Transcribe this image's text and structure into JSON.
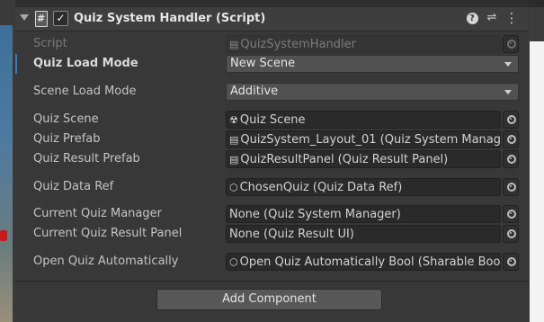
{
  "component": {
    "title": "Quiz System Handler (Script)",
    "enabled_mark": "✓",
    "header_icons": [
      "help-icon",
      "preset-icon",
      "context-menu-icon"
    ]
  },
  "fields": [
    {
      "label": "Script",
      "value": "QuizSystemHandler",
      "kind": "object",
      "icon": "script-asset-icon",
      "disabled": true
    },
    {
      "label": "Quiz Load Mode",
      "value": "New Scene",
      "kind": "dropdown"
    },
    {
      "label": "Scene Load Mode",
      "value": "Additive",
      "kind": "dropdown"
    },
    {
      "label": "Quiz Scene",
      "value": "Quiz Scene",
      "kind": "object",
      "icon": "scene-asset-icon"
    },
    {
      "label": "Quiz Prefab",
      "value": "QuizSystem_Layout_01 (Quiz System Manage",
      "kind": "object",
      "icon": "prefab-asset-icon"
    },
    {
      "label": "Quiz Result Prefab",
      "value": "QuizResultPanel (Quiz Result Panel)",
      "kind": "object",
      "icon": "prefab-asset-icon"
    },
    {
      "label": "Quiz Data Ref",
      "value": "ChosenQuiz (Quiz Data Ref)",
      "kind": "object",
      "icon": "scriptable-object-icon"
    },
    {
      "label": "Current Quiz Manager",
      "value": "None (Quiz System Manager)",
      "kind": "object"
    },
    {
      "label": "Current Quiz Result Panel",
      "value": "None (Quiz Result UI)",
      "kind": "object"
    },
    {
      "label": "Open Quiz Automatically",
      "value": "Open Quiz Automatically Bool (Sharable Bool)",
      "kind": "object",
      "icon": "scriptable-object-icon"
    }
  ],
  "add_component_label": "Add Component"
}
